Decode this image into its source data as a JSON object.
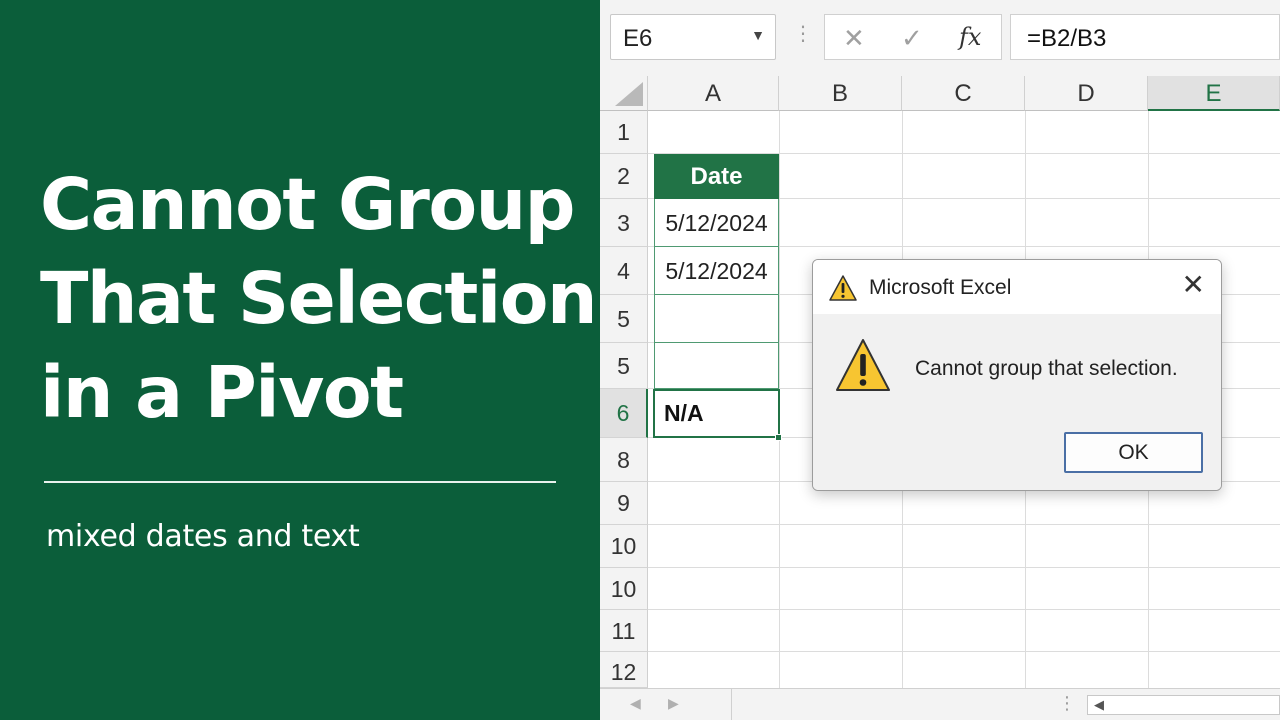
{
  "banner": {
    "title_lines": [
      "Cannot Group",
      "That Selection",
      "in a Pivot"
    ],
    "subtitle": "mixed dates and text",
    "background": "#0b5e3a"
  },
  "formula_bar": {
    "name_box": "E6",
    "name_box_arrow": "▼",
    "separator": "⋮",
    "cancel_icon": "✕",
    "enter_icon": "✓",
    "fx_label": "fx",
    "formula": "=B2/B3"
  },
  "grid": {
    "columns": [
      "A",
      "B",
      "C",
      "D",
      "E"
    ],
    "selected_column": "E",
    "rows": [
      "1",
      "2",
      "3",
      "4",
      "5",
      "5",
      "6",
      "8",
      "9",
      "10",
      "10",
      "11",
      "12"
    ],
    "selected_row": "6",
    "cells": {
      "a2": "Date",
      "a3": "5/12/2024",
      "a4": "5/12/2024",
      "a6": "N/A"
    },
    "accent": "#217346"
  },
  "bottom_bar": {
    "prev_sheet": "◀",
    "next_sheet": "▶",
    "dots": "⋮",
    "scroll_left": "◀"
  },
  "dialog": {
    "title": "Microsoft Excel",
    "close": "✕",
    "message": "Cannot group that selection.",
    "ok_label": "OK",
    "warning_icon": "warning-triangle-icon"
  }
}
